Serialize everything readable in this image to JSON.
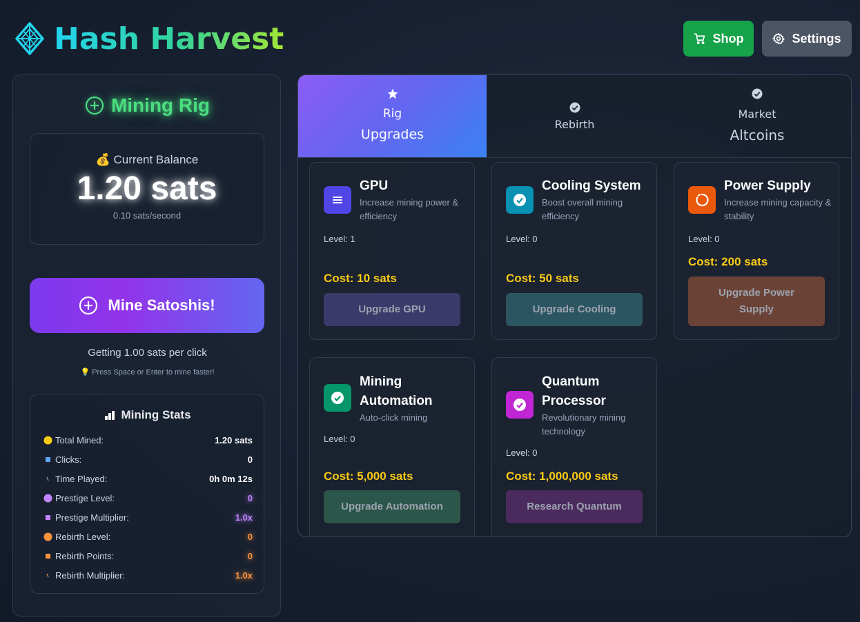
{
  "header": {
    "title": "Hash Harvest",
    "shop_label": "Shop",
    "settings_label": "Settings"
  },
  "rig": {
    "title": "Mining Rig",
    "balance_label": "💰 Current Balance",
    "balance_value": "1.20 sats",
    "rate": "0.10 sats/second",
    "mine_button": "Mine Satoshis!",
    "per_click": "Getting 1.00 sats per click",
    "hint": "💡 Press Space or Enter to mine faster!"
  },
  "stats": {
    "title": "Mining Stats",
    "rows": [
      {
        "label": "Total Mined:",
        "value": "1.20 sats"
      },
      {
        "label": "Clicks:",
        "value": "0"
      },
      {
        "label": "Time Played:",
        "value": "0h 0m 12s"
      },
      {
        "label": "Prestige Level:",
        "value": "0"
      },
      {
        "label": "Prestige Multiplier:",
        "value": "1.0x"
      },
      {
        "label": "Rebirth Level:",
        "value": "0"
      },
      {
        "label": "Rebirth Points:",
        "value": "0"
      },
      {
        "label": "Rebirth Multiplier:",
        "value": "1.0x"
      }
    ]
  },
  "tabs": {
    "rig_line1": "Rig",
    "rig_line2": "Upgrades",
    "rebirth": "Rebirth",
    "market_line1": "Market",
    "market_line2": "Altcoins"
  },
  "upgrades": [
    {
      "name": "GPU",
      "desc": "Increase mining power & efficiency",
      "level": "Level: 1",
      "cost": "Cost: 10 sats",
      "button": "Upgrade GPU",
      "color": "#4f46e5"
    },
    {
      "name": "Cooling System",
      "desc": "Boost overall mining efficiency",
      "level": "Level: 0",
      "cost": "Cost: 50 sats",
      "button": "Upgrade Cooling",
      "color": "#0891b2"
    },
    {
      "name": "Power Supply",
      "desc": "Increase mining capacity & stability",
      "level": "Level: 0",
      "cost": "Cost: 200 sats",
      "button": "Upgrade Power Supply",
      "color": "#ea580c"
    },
    {
      "name": "Mining Automation",
      "desc": "Auto-click mining",
      "level": "Level: 0",
      "cost": "Cost: 5,000 sats",
      "button": "Upgrade Automation",
      "color": "#059669"
    },
    {
      "name": "Quantum Processor",
      "desc": "Revolutionary mining technology",
      "level": "Level: 0",
      "cost": "Cost: 1,000,000 sats",
      "button": "Research Quantum",
      "color": "#c026d3"
    }
  ],
  "colors": {
    "accent_green": "#4ade80",
    "cost_yellow": "#facc15",
    "shop_green": "#16a34a"
  }
}
